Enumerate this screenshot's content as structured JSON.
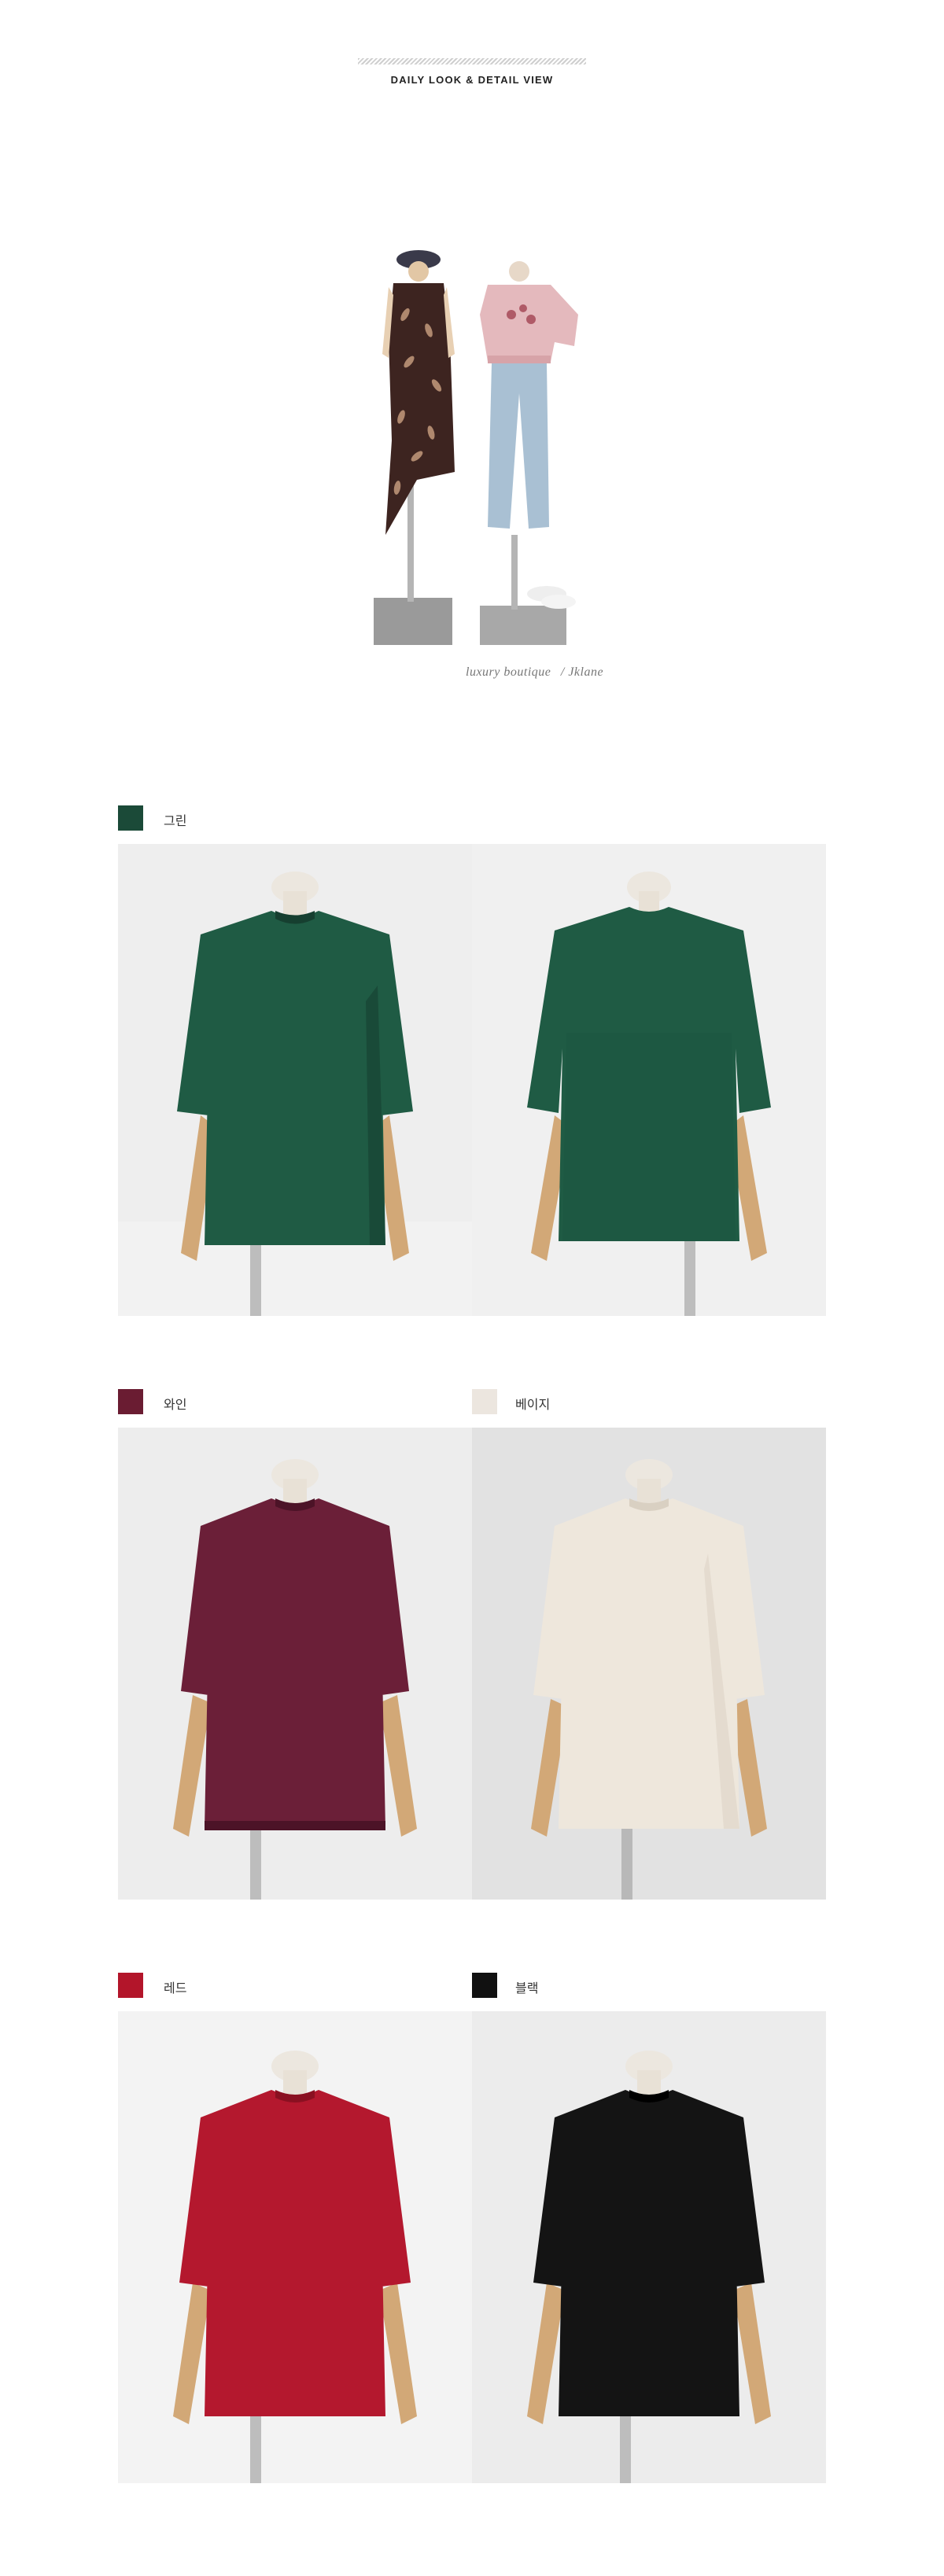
{
  "header": {
    "title": "DAILY LOOK & DETAIL VIEW",
    "brand_text": "luxury boutique",
    "brand_signature": "/ Jklane"
  },
  "colors": [
    {
      "label": "그린",
      "swatch": "#1b4a38",
      "garment": "#1f5b44",
      "garment_shade": "#163f30"
    },
    {
      "label": "와인",
      "swatch": "#6a1c32",
      "garment": "#6b1f38",
      "garment_shade": "#4c1327"
    },
    {
      "label": "베이지",
      "swatch": "#ece6df",
      "garment": "#eee7dc",
      "garment_shade": "#d9d0c2"
    },
    {
      "label": "레드",
      "swatch": "#b3152a",
      "garment": "#b4182e",
      "garment_shade": "#8a1021"
    },
    {
      "label": "블랙",
      "swatch": "#111111",
      "garment": "#141414",
      "garment_shade": "#000000"
    }
  ]
}
